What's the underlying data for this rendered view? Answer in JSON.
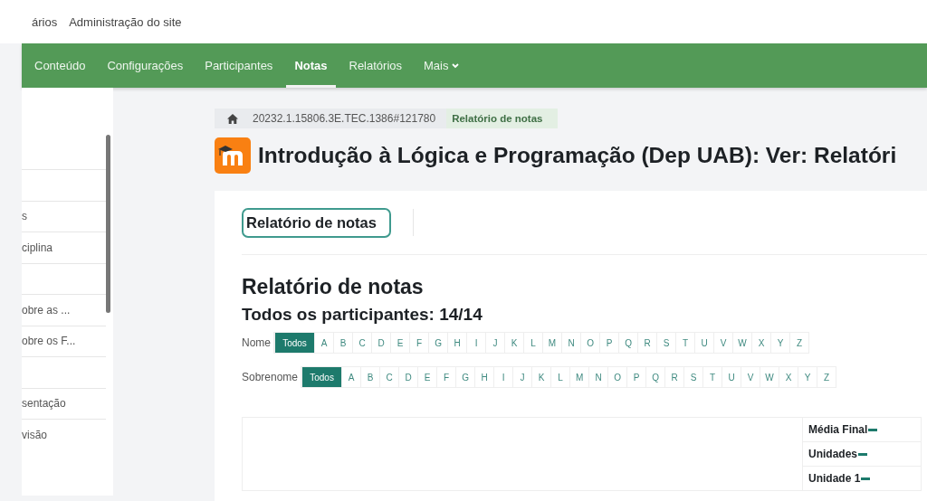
{
  "top_links": [
    "ários",
    "Administração do site"
  ],
  "nav": [
    {
      "label": "Conteúdo",
      "selected": false
    },
    {
      "label": "Configurações",
      "selected": false
    },
    {
      "label": "Participantes",
      "selected": false
    },
    {
      "label": "Notas",
      "selected": true
    },
    {
      "label": "Relatórios",
      "selected": false
    },
    {
      "label": "Mais",
      "selected": false,
      "kind": "dropdown"
    }
  ],
  "sidebar": {
    "items": [
      {
        "kind": "blank"
      },
      {
        "kind": "text",
        "label": "s"
      },
      {
        "kind": "text",
        "label": "ciplina"
      },
      {
        "kind": "blank"
      },
      {
        "kind": "text",
        "label": "obre as ..."
      },
      {
        "kind": "text",
        "label": "obre os F..."
      },
      {
        "kind": "blank"
      },
      {
        "kind": "text",
        "label": "sentação"
      },
      {
        "kind": "text",
        "label": "visão"
      }
    ]
  },
  "breadcrumb": [
    "20232.1.15806.3E.TEC.1386#121780",
    "Relatório de notas"
  ],
  "page_title": "Introdução à Lógica e Programação (Dep UAB): Ver: Relatóri",
  "report_selector": "Relatório de notas",
  "heading": "Relatório de notas",
  "subheading": "Todos os participantes: 14/14",
  "filters": [
    {
      "label": "Nome",
      "options": [
        {
          "text": "Todos",
          "selected": true
        },
        {
          "text": "A",
          "selected": false
        },
        {
          "text": "B",
          "selected": false
        },
        {
          "text": "C",
          "selected": false
        },
        {
          "text": "D",
          "selected": false
        },
        {
          "text": "E",
          "selected": false
        },
        {
          "text": "F",
          "selected": false
        },
        {
          "text": "G",
          "selected": false
        },
        {
          "text": "H",
          "selected": false
        },
        {
          "text": "I",
          "selected": false
        },
        {
          "text": "J",
          "selected": false
        },
        {
          "text": "K",
          "selected": false
        },
        {
          "text": "L",
          "selected": false
        },
        {
          "text": "M",
          "selected": false
        },
        {
          "text": "N",
          "selected": false
        },
        {
          "text": "O",
          "selected": false
        },
        {
          "text": "P",
          "selected": false
        },
        {
          "text": "Q",
          "selected": false
        },
        {
          "text": "R",
          "selected": false
        },
        {
          "text": "S",
          "selected": false
        },
        {
          "text": "T",
          "selected": false
        },
        {
          "text": "U",
          "selected": false
        },
        {
          "text": "V",
          "selected": false
        },
        {
          "text": "W",
          "selected": false
        },
        {
          "text": "X",
          "selected": false
        },
        {
          "text": "Y",
          "selected": false
        },
        {
          "text": "Z",
          "selected": false
        }
      ]
    },
    {
      "label": "Sobrenome",
      "options": [
        {
          "text": "Todos",
          "selected": true
        },
        {
          "text": "A",
          "selected": false
        },
        {
          "text": "B",
          "selected": false
        },
        {
          "text": "C",
          "selected": false
        },
        {
          "text": "D",
          "selected": false
        },
        {
          "text": "E",
          "selected": false
        },
        {
          "text": "F",
          "selected": false
        },
        {
          "text": "G",
          "selected": false
        },
        {
          "text": "H",
          "selected": false
        },
        {
          "text": "I",
          "selected": false
        },
        {
          "text": "J",
          "selected": false
        },
        {
          "text": "K",
          "selected": false
        },
        {
          "text": "L",
          "selected": false
        },
        {
          "text": "M",
          "selected": false
        },
        {
          "text": "N",
          "selected": false
        },
        {
          "text": "O",
          "selected": false
        },
        {
          "text": "P",
          "selected": false
        },
        {
          "text": "Q",
          "selected": false
        },
        {
          "text": "R",
          "selected": false
        },
        {
          "text": "S",
          "selected": false
        },
        {
          "text": "T",
          "selected": false
        },
        {
          "text": "U",
          "selected": false
        },
        {
          "text": "V",
          "selected": false
        },
        {
          "text": "W",
          "selected": false
        },
        {
          "text": "X",
          "selected": false
        },
        {
          "text": "Y",
          "selected": false
        },
        {
          "text": "Z",
          "selected": false
        }
      ]
    }
  ],
  "table": {
    "header_rows": [
      "Média Final",
      "Unidades",
      "Unidade 1"
    ]
  }
}
